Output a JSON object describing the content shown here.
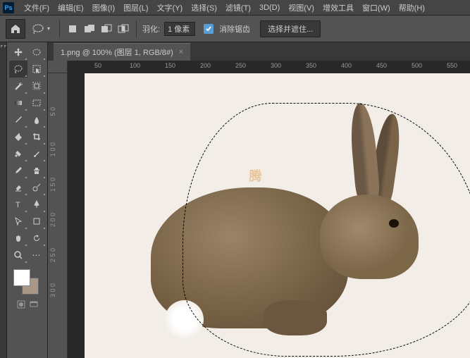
{
  "menu": {
    "items": [
      "文件(F)",
      "编辑(E)",
      "图像(I)",
      "图层(L)",
      "文字(Y)",
      "选择(S)",
      "滤镜(T)",
      "3D(D)",
      "视图(V)",
      "增效工具",
      "窗口(W)",
      "帮助(H)"
    ]
  },
  "options": {
    "feather_label": "羽化:",
    "feather_value": "1 像素",
    "antialias_label": "消除锯齿",
    "select_mask": "选择并遮住..."
  },
  "tab": {
    "title": "1.png @ 100% (图层 1, RGB/8#)",
    "close": "×"
  },
  "ruler_h": [
    "50",
    "100",
    "150",
    "200",
    "250",
    "300",
    "350",
    "400",
    "450",
    "500",
    "550"
  ],
  "ruler_v": [
    "5 0",
    "1 0 0",
    "1 5 0",
    "2 0 0",
    "2 5 0",
    "3 0 0"
  ],
  "watermark": "腾",
  "colors": {
    "foreground": "#ffffff",
    "background": "#a89888"
  }
}
